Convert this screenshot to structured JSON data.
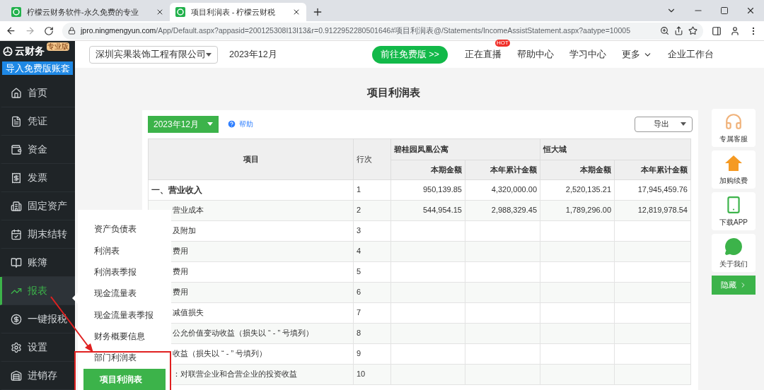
{
  "browser": {
    "tabs": [
      {
        "title": "柠檬云财务软件-永久免费的专业",
        "selected": false
      },
      {
        "title": "项目利润表 - 柠檬云财税",
        "selected": true
      }
    ],
    "url_host": "jpro.ningmengyun.com",
    "url_path": "/App/Default.aspx?appasid=200125308I13I13&r=0.9122952280501646#项目利润表@/Statements/IncomeAssistStatement.aspx?aatype=10005"
  },
  "header": {
    "company": "深圳宾果装饰工程有限公司",
    "period": "2023年12月",
    "cta": "前往免费版 >>",
    "nav": [
      {
        "label": "正在直播",
        "badge": "HOT",
        "caret": false
      },
      {
        "label": "帮助中心",
        "caret": false
      },
      {
        "label": "学习中心",
        "caret": false
      },
      {
        "label": "更多",
        "caret": true
      },
      {
        "label": "企业工作台",
        "caret": false
      }
    ]
  },
  "sidebar": {
    "logo": "云财务",
    "edition": "专业版",
    "import_button": "导入免费版账套",
    "items": [
      {
        "label": "首页",
        "selected": false
      },
      {
        "label": "凭证",
        "selected": false
      },
      {
        "label": "资金",
        "selected": false
      },
      {
        "label": "发票",
        "selected": false
      },
      {
        "label": "固定资产",
        "selected": false
      },
      {
        "label": "期末结转",
        "selected": false
      },
      {
        "label": "账簿",
        "selected": false
      },
      {
        "label": "报表",
        "selected": true
      },
      {
        "label": "一键报税",
        "selected": false
      },
      {
        "label": "设置",
        "selected": false
      },
      {
        "label": "进销存",
        "selected": false
      }
    ]
  },
  "submenu": {
    "items": [
      {
        "label": "资产负债表",
        "selected": false
      },
      {
        "label": "利润表",
        "selected": false
      },
      {
        "label": "利润表季报",
        "selected": false
      },
      {
        "label": "现金流量表",
        "selected": false
      },
      {
        "label": "现金流量表季报",
        "selected": false
      },
      {
        "label": "财务概要信息",
        "selected": false
      },
      {
        "label": "部门利润表",
        "selected": false
      },
      {
        "label": "项目利润表",
        "selected": true
      }
    ]
  },
  "page": {
    "title": "项目利润表",
    "period_button": "2023年12月",
    "help": "帮助",
    "export": "导出",
    "table": {
      "col_item": "项目",
      "col_line": "行次",
      "groups": [
        {
          "name": "碧桂园凤凰公寓",
          "columns": [
            "本期金额",
            "本年累计金额"
          ]
        },
        {
          "name": "恒大城",
          "columns": [
            "本期金额",
            "本年累计金额"
          ]
        }
      ],
      "rows": [
        {
          "label": "一、营业收入",
          "kind": "heading",
          "line": "1",
          "values": [
            "950,139.85",
            "4,320,000.00",
            "2,520,135.21",
            "17,945,459.76"
          ]
        },
        {
          "label": "营业成本",
          "kind": "sub",
          "line": "2",
          "values": [
            "544,954.15",
            "2,988,329.45",
            "1,789,296.00",
            "12,819,978.54"
          ]
        },
        {
          "label": "及附加",
          "kind": "sub",
          "line": "3",
          "values": []
        },
        {
          "label": "费用",
          "kind": "sub",
          "line": "4",
          "values": []
        },
        {
          "label": "费用",
          "kind": "sub",
          "line": "5",
          "values": []
        },
        {
          "label": "费用",
          "kind": "sub",
          "line": "6",
          "values": []
        },
        {
          "label": "减值损失",
          "kind": "sub",
          "line": "7",
          "values": []
        },
        {
          "label": "公允价值变动收益（损失以 “ - ” 号填列）",
          "kind": "sub",
          "line": "8",
          "values": []
        },
        {
          "label": "收益（损失以 “ - ” 号填列）",
          "kind": "sub",
          "line": "9",
          "values": []
        },
        {
          "label": "：对联营企业和合营企业的投资收益",
          "kind": "sub",
          "line": "10",
          "values": []
        }
      ]
    }
  },
  "side_panel": {
    "items": [
      {
        "label": "专属客服",
        "kind": "headset"
      },
      {
        "label": "加购续费",
        "kind": "renew"
      },
      {
        "label": "下载APP",
        "kind": "phone"
      },
      {
        "label": "关于我们",
        "kind": "chat"
      }
    ],
    "hide_button": "隐藏"
  }
}
